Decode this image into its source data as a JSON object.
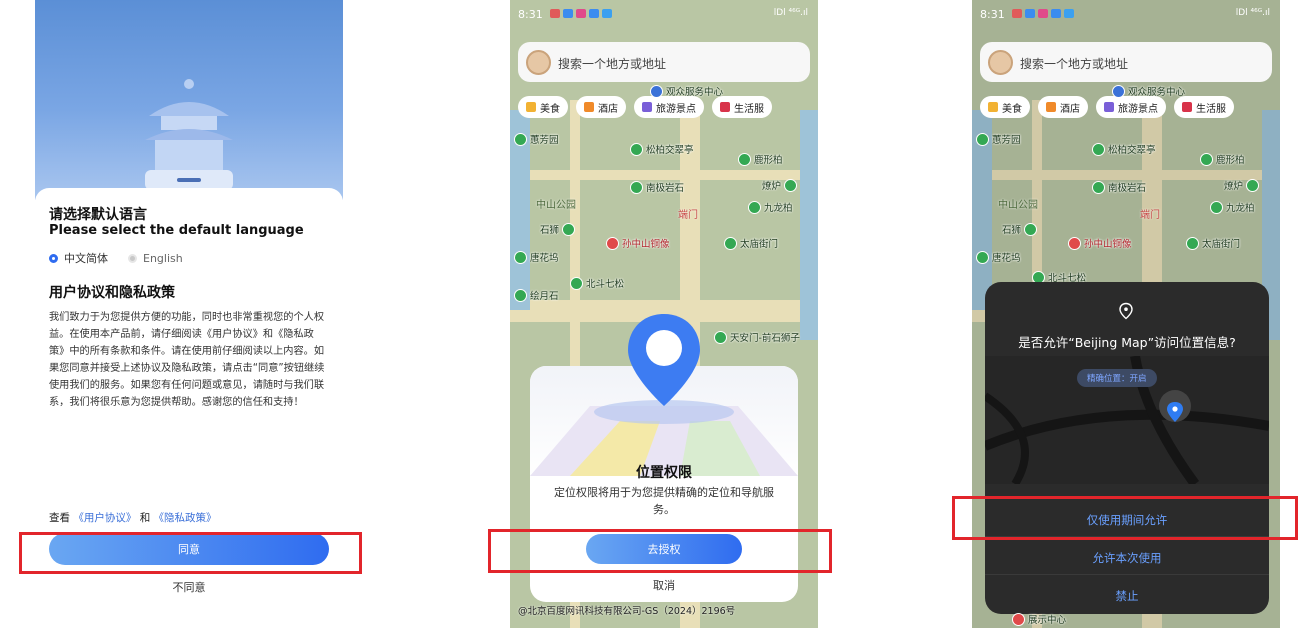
{
  "screen1": {
    "title_zh": "请选择默认语言",
    "title_en": "Please select the default language",
    "lang_options": [
      "中文简体",
      "English"
    ],
    "policy_title": "用户协议和隐私政策",
    "policy_body": "我们致力于为您提供方便的功能，同时也非常重视您的个人权益。在使用本产品前，请仔细阅读《用户协议》和《隐私政策》中的所有条款和条件。请在使用前仔细阅读以上内容。如果您同意并接受上述协议及隐私政策，请点击“同意”按钮继续使用我们的服务。如果您有任何问题或意见，请随时与我们联系，我们将很乐意为您提供帮助。感谢您的信任和支持！",
    "links_prefix": "查看",
    "user_agreement_link": "《用户协议》",
    "links_and": "和",
    "privacy_link": "《隐私政策》",
    "agree_label": "同意",
    "disagree_label": "不同意"
  },
  "status": {
    "time": "8:31",
    "signal": "lDl ⁴⁶ᴳ.ıl"
  },
  "map": {
    "search_placeholder": "搜索一个地方或地址",
    "chips": [
      "美食",
      "酒店",
      "旅游景点",
      "生活服"
    ],
    "pois": [
      "观众服务中心",
      "蕙芳园",
      "松柏交翠亭",
      "鹿形柏",
      "南极岩石",
      "燎炉",
      "九龙柏",
      "中山公园",
      "端门",
      "石狮",
      "孙中山铜像",
      "太庙街门",
      "唐花坞",
      "北斗七松",
      "绘月石",
      "天安门-前石狮子",
      "展示中心"
    ],
    "copyright": "@北京百度网讯科技有限公司-GS（2024）2196号"
  },
  "screen2": {
    "dialog_title": "位置权限",
    "dialog_desc": "定位权限将用于为您提供精确的定位和导航服务。",
    "authorize_label": "去授权",
    "cancel_label": "取消"
  },
  "screen3": {
    "dialog_title": "是否允许“Beijing Map”访问位置信息?",
    "precise_label": "精确位置：开启",
    "option_while_using": "仅使用期间允许",
    "option_once": "允许本次使用",
    "option_deny": "禁止"
  },
  "colors": {
    "accent": "#2f6cf0",
    "highlight": "#e2252b",
    "dialog_dark": "#2b2b2b"
  }
}
